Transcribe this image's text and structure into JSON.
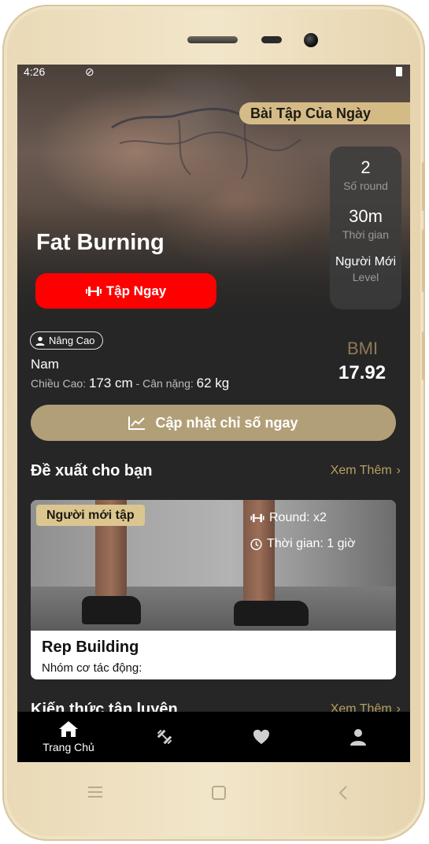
{
  "status_bar": {
    "time": "4:26"
  },
  "hero": {
    "daily_label": "Bài Tập Của Ngày",
    "title": "Fat Burning",
    "start_button": "Tập Ngay",
    "stats": [
      {
        "value": "2",
        "label": "Số round"
      },
      {
        "value": "30m",
        "label": "Thời gian"
      },
      {
        "value": "Người Mới",
        "label": "Level"
      }
    ]
  },
  "profile": {
    "level_chip": "Nâng Cao",
    "gender": "Nam",
    "height_label": "Chiều Cao:",
    "height_value": "173 cm",
    "separator": "-",
    "weight_label": "Cân nặng:",
    "weight_value": "62 kg",
    "bmi_label": "BMI",
    "bmi_value": "17.92",
    "update_button": "Cập nhật chỉ số ngay"
  },
  "recommend": {
    "title": "Đề xuất cho bạn",
    "more": "Xem Thêm",
    "card": {
      "tag": "Người mới tập",
      "round": "Round: x2",
      "time": "Thời gian: 1 giờ",
      "name": "Rep Building",
      "muscle_label": "Nhóm cơ tác động:"
    }
  },
  "knowledge": {
    "title": "Kiến thức tập luyện",
    "more": "Xem Thêm"
  },
  "tabs": [
    {
      "icon": "home-icon",
      "label": "Trang Chủ",
      "active": true
    },
    {
      "icon": "dumbbell-icon"
    },
    {
      "icon": "heart-icon"
    },
    {
      "icon": "user-icon"
    }
  ],
  "colors": {
    "accent_gold": "#b19f77",
    "cta_red": "#ff0000",
    "background": "#262626",
    "tabbar": "#000000"
  }
}
